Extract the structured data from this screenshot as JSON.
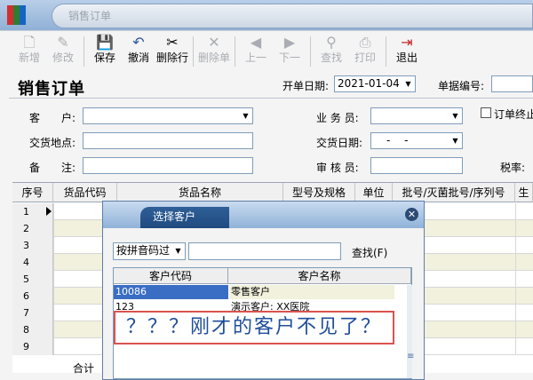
{
  "window": {
    "tab_title": "销售订单"
  },
  "toolbar": [
    {
      "label": "新增",
      "icon": "new-doc-icon",
      "glyph": "🗋",
      "enabled": false
    },
    {
      "label": "修改",
      "icon": "edit-doc-icon",
      "glyph": "✎",
      "enabled": false
    },
    {
      "label": "保存",
      "icon": "save-icon",
      "glyph": "💾",
      "enabled": true
    },
    {
      "label": "撤消",
      "icon": "undo-icon",
      "glyph": "↶",
      "enabled": true
    },
    {
      "label": "删除行",
      "icon": "delete-row-icon",
      "glyph": "✂",
      "enabled": true
    },
    {
      "label": "删除单",
      "icon": "delete-doc-icon",
      "glyph": "✕",
      "enabled": false
    },
    {
      "label": "上一",
      "icon": "prev-icon",
      "glyph": "◀",
      "enabled": false
    },
    {
      "label": "下一",
      "icon": "next-icon",
      "glyph": "▶",
      "enabled": false
    },
    {
      "label": "查找",
      "icon": "binoculars-icon",
      "glyph": "⚲",
      "enabled": false
    },
    {
      "label": "打印",
      "icon": "printer-icon",
      "glyph": "⎙",
      "enabled": false
    },
    {
      "label": "退出",
      "icon": "exit-icon",
      "glyph": "⇥",
      "enabled": true
    }
  ],
  "form": {
    "title": "销售订单",
    "open_date_label": "开单日期:",
    "open_date_value": "2021-01-04",
    "doc_no_label": "单据编号:",
    "customer_label": "客　　户:",
    "salesperson_label": "业 务 员:",
    "order_end_label": "订单终止",
    "delivery_place_label": "交货地点:",
    "delivery_date_label": "交货日期:",
    "delivery_date_value": "-　 -",
    "note_label": "备　　注:",
    "auditor_label": "审 核 员:",
    "tax_label": "税率:"
  },
  "grid": {
    "columns": [
      "序号",
      "货品代码",
      "货品名称",
      "型号及规格",
      "单位",
      "批号/灭菌批号/序列号",
      "生"
    ],
    "rows": [
      "1",
      "2",
      "3",
      "4",
      "5",
      "6",
      "7",
      "8",
      "9"
    ],
    "total_label": "合计"
  },
  "dialog": {
    "title": "选择客户",
    "search_mode": "按拼音码过",
    "search_value": "",
    "find_label": "查找(F)",
    "columns": [
      "客户代码",
      "客户名称"
    ],
    "rows": [
      {
        "code": "10086",
        "name": "零售客户"
      },
      {
        "code": "123",
        "name": "演示客户: XX医院"
      }
    ],
    "annotation": "？？？刚才的客户不见了？"
  },
  "colors": {
    "selected_row": "#3a6ec4",
    "callout_border": "#d9534f",
    "callout_text": "#1f4e9c",
    "alt_row": "#f2f1dd"
  }
}
